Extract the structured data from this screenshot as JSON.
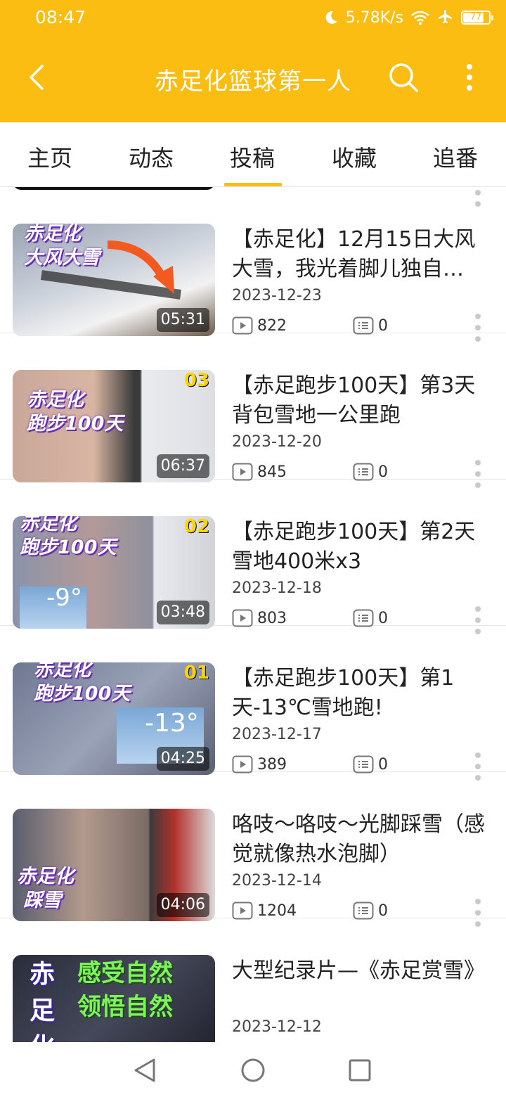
{
  "status": {
    "time": "08:47",
    "net_speed": "5.78K/s",
    "battery": "77"
  },
  "appbar": {
    "title": "赤足化篮球第一人"
  },
  "tabs": [
    {
      "label": "主页"
    },
    {
      "label": "动态"
    },
    {
      "label": "投稿",
      "selected": true
    },
    {
      "label": "收藏"
    },
    {
      "label": "追番"
    }
  ],
  "videos": [
    {
      "title": "【赤足化】12月15日大风大雪，我光着脚儿独自…",
      "date": "2023-12-23",
      "duration": "05:31",
      "views": "822",
      "comments": "0",
      "thumb_caption": "赤足化\n大风大雪",
      "thumb_badge": ""
    },
    {
      "title": "【赤足跑步100天】第3天背包雪地一公里跑",
      "date": "2023-12-20",
      "duration": "06:37",
      "views": "845",
      "comments": "0",
      "thumb_caption": "赤足化\n跑步100天",
      "thumb_badge": "03"
    },
    {
      "title": "【赤足跑步100天】第2天雪地400米x3",
      "date": "2023-12-18",
      "duration": "03:48",
      "views": "803",
      "comments": "0",
      "thumb_caption": "赤足化\n跑步100天",
      "thumb_badge": "02"
    },
    {
      "title": "【赤足跑步100天】第1天-13℃雪地跑!",
      "date": "2023-12-17",
      "duration": "04:25",
      "views": "389",
      "comments": "0",
      "thumb_caption": "赤足化\n跑步100天",
      "thumb_badge": "01"
    },
    {
      "title": "咯吱～咯吱～光脚踩雪（感觉就像热水泡脚）",
      "date": "2023-12-14",
      "duration": "04:06",
      "views": "1204",
      "comments": "0",
      "thumb_caption": "赤足化\n踩雪",
      "thumb_badge": ""
    },
    {
      "title": "大型纪录片—《赤足赏雪》",
      "date": "2023-12-12",
      "duration": "",
      "views": "",
      "comments": "",
      "thumb_caption": "感受自然\n领悟自然",
      "thumb_badge": ""
    }
  ],
  "colors": {
    "brand": "#fbbd12",
    "text": "#222222",
    "divider": "#e8e8e8"
  },
  "icons": {
    "back": "chevron-left-icon",
    "search": "search-icon",
    "more": "more-vertical-icon",
    "views": "play-count-icon",
    "comments": "danmaku-icon"
  }
}
